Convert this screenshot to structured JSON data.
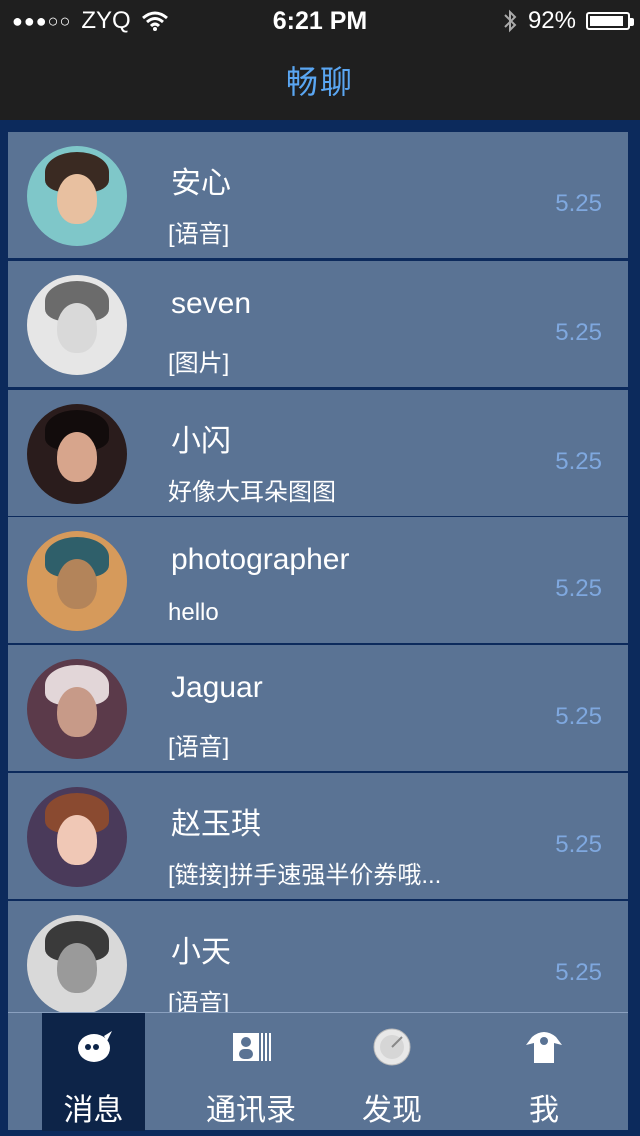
{
  "status": {
    "carrier": "ZYQ",
    "time": "6:21 PM",
    "battery": "92%",
    "battery_level": 0.92
  },
  "nav": {
    "title": "畅聊"
  },
  "chats": [
    {
      "name": "安心",
      "preview": "[语音]",
      "date": "5.25",
      "avatar": "avatar-photo"
    },
    {
      "name": "seven",
      "preview": "[图片]",
      "date": "5.25",
      "avatar": "avatar-photo"
    },
    {
      "name": "小闪",
      "preview": "好像大耳朵图图",
      "date": "5.25",
      "avatar": "avatar-photo"
    },
    {
      "name": "photographer",
      "preview": "hello",
      "date": "5.25",
      "avatar": "avatar-photo"
    },
    {
      "name": "Jaguar",
      "preview": "[语音]",
      "date": "5.25",
      "avatar": "avatar-photo"
    },
    {
      "name": "赵玉琪",
      "preview": "[链接]拼手速强半价券哦...",
      "date": "5.25",
      "avatar": "avatar-photo"
    },
    {
      "name": "小天",
      "preview": "[语音]",
      "date": "5.25",
      "avatar": "avatar-photo"
    }
  ],
  "tabs": [
    {
      "label": "消息",
      "icon": "chat-bubble-icon",
      "active": true
    },
    {
      "label": "通讯录",
      "icon": "contacts-icon",
      "active": false
    },
    {
      "label": "发现",
      "icon": "compass-icon",
      "active": false
    },
    {
      "label": "我",
      "icon": "person-icon",
      "active": false
    }
  ],
  "colors": {
    "background": "#0c2a5c",
    "row": "#5a7394",
    "title": "#5aa6f2",
    "date": "#7fa8df",
    "tab_active": "#0d2448"
  }
}
